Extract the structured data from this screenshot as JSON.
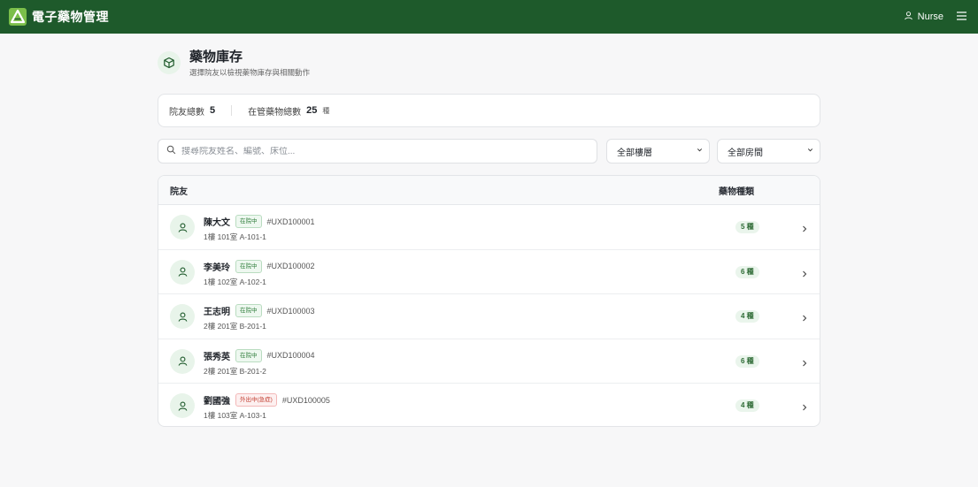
{
  "app": {
    "title": "電子藥物管理"
  },
  "user": {
    "name": "Nurse"
  },
  "page": {
    "title": "藥物庫存",
    "subtitle": "選擇院友以檢視藥物庫存與相關動作"
  },
  "stats": {
    "residents_label": "院友總數",
    "residents_value": "5",
    "meds_label": "在管藥物總數",
    "meds_value": "25",
    "meds_unit": "種"
  },
  "search": {
    "placeholder": "搜尋院友姓名、編號、床位..."
  },
  "filters": {
    "floor": "全部樓層",
    "room": "全部房間"
  },
  "table": {
    "col_resident": "院友",
    "col_types": "藥物種類",
    "rows": [
      {
        "name": "陳大文",
        "status": "在院中",
        "status_type": "ok",
        "id": "#UXD100001",
        "location": "1樓 101室 A-101-1",
        "count": "5 種"
      },
      {
        "name": "李美玲",
        "status": "在院中",
        "status_type": "ok",
        "id": "#UXD100002",
        "location": "1樓 102室 A-102-1",
        "count": "6 種"
      },
      {
        "name": "王志明",
        "status": "在院中",
        "status_type": "ok",
        "id": "#UXD100003",
        "location": "2樓 201室 B-201-1",
        "count": "4 種"
      },
      {
        "name": "張秀英",
        "status": "在院中",
        "status_type": "ok",
        "id": "#UXD100004",
        "location": "2樓 201室 B-201-2",
        "count": "6 種"
      },
      {
        "name": "劉國強",
        "status": "外出中(急症)",
        "status_type": "warn",
        "id": "#UXD100005",
        "location": "1樓 103室 A-103-1",
        "count": "4 種"
      }
    ]
  },
  "colors": {
    "brand": "#1e5a2b",
    "accent": "#2e7d3a",
    "warn": "#c0392b"
  },
  "icons": [
    "logo-icon",
    "user-icon",
    "menu-icon",
    "box-icon",
    "search-icon",
    "chevron-down-icon",
    "person-icon",
    "chevron-right-icon"
  ]
}
